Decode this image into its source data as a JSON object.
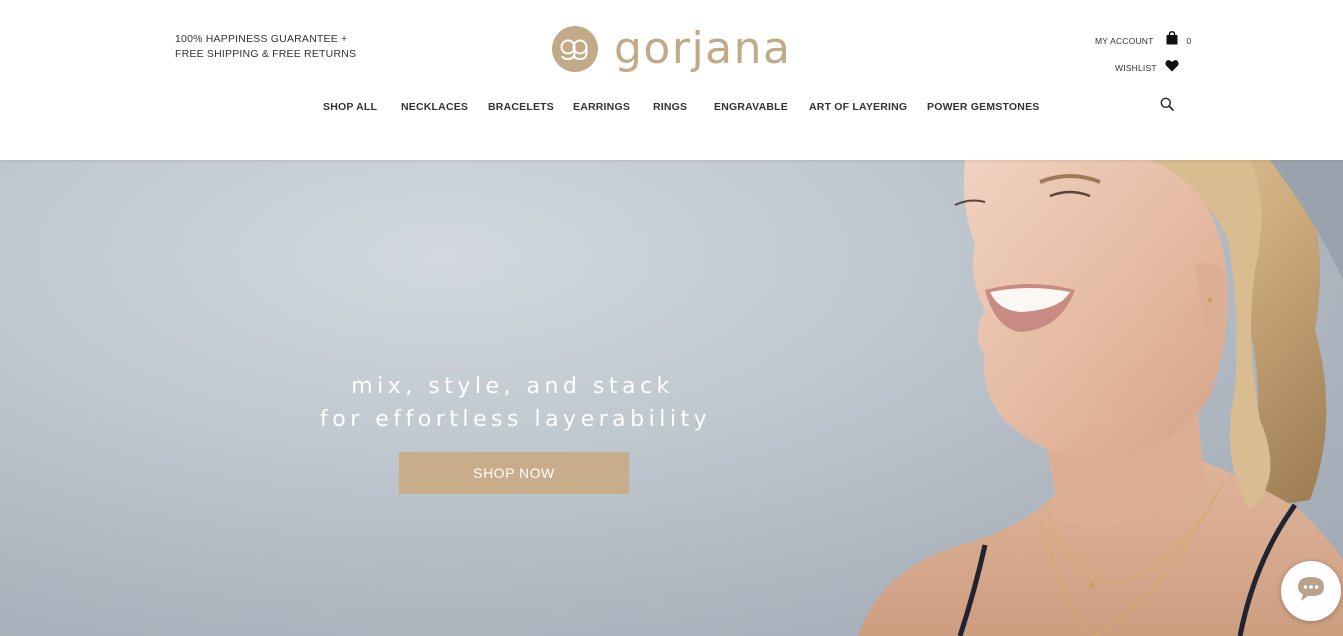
{
  "promo": {
    "line1": "100% HAPPINESS GUARANTEE +",
    "line2": "FREE SHIPPING & FREE RETURNS"
  },
  "brand": {
    "name": "gorjana",
    "monogram": "gg",
    "color": "#c2aa88"
  },
  "account": {
    "my_account": "MY ACCOUNT",
    "cart_count": "0",
    "wishlist": "WISHLIST"
  },
  "nav": {
    "items": [
      "SHOP ALL",
      "NECKLACES",
      "BRACELETS",
      "EARRINGS",
      "RINGS",
      "ENGRAVABLE",
      "ART OF LAYERING",
      "POWER GEMSTONES"
    ]
  },
  "icons": {
    "search": "search-icon",
    "cart": "shopping-bag-icon",
    "wishlist": "heart-icon",
    "chat": "chat-bubble-icon"
  },
  "hero": {
    "line1": "mix, style, and stack",
    "line2": "for effortless layerability",
    "cta": "SHOP NOW",
    "cta_color": "#c9ad8b"
  }
}
